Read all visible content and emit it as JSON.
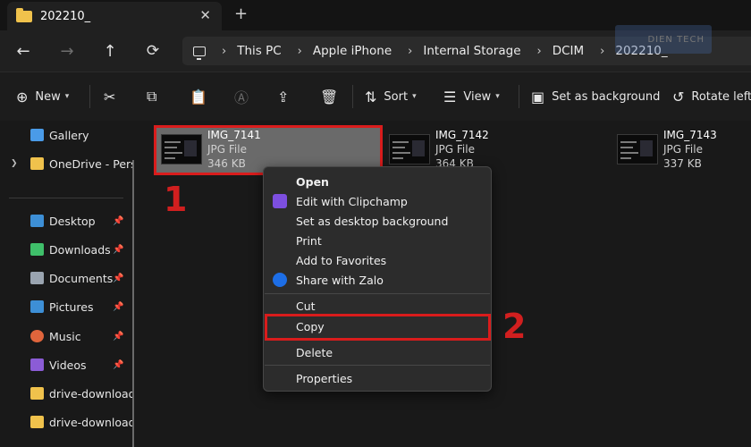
{
  "tab": {
    "title": "202210_",
    "close": "✕",
    "new_tab": "+"
  },
  "nav": {
    "back": "←",
    "forward": "→",
    "up": "↑",
    "refresh": "⟳"
  },
  "breadcrumb": {
    "separator": "›",
    "items": [
      "This PC",
      "Apple iPhone",
      "Internal Storage",
      "DCIM",
      "202210_"
    ]
  },
  "watermark": "DIEN TECH",
  "toolbar": {
    "new_label": "New",
    "sort_label": "Sort",
    "view_label": "View",
    "set_background_label": "Set as background",
    "rotate_left_label": "Rotate left",
    "icons": [
      "plus-circle-icon",
      "cut-icon",
      "copy-icon",
      "paste-icon",
      "rename-icon",
      "share-icon",
      "delete-icon",
      "sort-icon",
      "view-icon",
      "wallpaper-icon",
      "rotate-left-icon"
    ]
  },
  "sidebar": {
    "items": [
      {
        "label": "Gallery",
        "icon": "gallery-icon",
        "color": "#4a9be8",
        "pinned": false,
        "expandable": false
      },
      {
        "label": "OneDrive - Perso",
        "icon": "folder-icon",
        "color": "#f0c24c",
        "pinned": false,
        "expandable": true
      },
      {
        "label": "Desktop",
        "icon": "desktop-icon",
        "color": "#3d8fd6",
        "pinned": true,
        "expandable": false
      },
      {
        "label": "Downloads",
        "icon": "download-icon",
        "color": "#3fbf6a",
        "pinned": true,
        "expandable": false
      },
      {
        "label": "Documents",
        "icon": "documents-icon",
        "color": "#9aa4b0",
        "pinned": true,
        "expandable": false
      },
      {
        "label": "Pictures",
        "icon": "pictures-icon",
        "color": "#3d8fd6",
        "pinned": true,
        "expandable": false
      },
      {
        "label": "Music",
        "icon": "music-icon",
        "color": "#e0653c",
        "pinned": true,
        "expandable": false
      },
      {
        "label": "Videos",
        "icon": "videos-icon",
        "color": "#8b5cd6",
        "pinned": true,
        "expandable": false
      },
      {
        "label": "drive-download",
        "icon": "folder-icon",
        "color": "#f0c24c",
        "pinned": false,
        "expandable": false
      },
      {
        "label": "drive-download",
        "icon": "folder-icon",
        "color": "#f0c24c",
        "pinned": false,
        "expandable": false
      }
    ],
    "pin_glyph": "📌"
  },
  "files": [
    {
      "name": "IMG_7141",
      "type": "JPG File",
      "size": "346 KB",
      "selected": true
    },
    {
      "name": "IMG_7142",
      "type": "JPG File",
      "size": "364 KB",
      "selected": false
    },
    {
      "name": "IMG_7143",
      "type": "JPG File",
      "size": "337 KB",
      "selected": false
    }
  ],
  "context_menu": {
    "items": [
      {
        "label": "Open",
        "bold": true,
        "icon": ""
      },
      {
        "label": "Edit with Clipchamp",
        "bold": false,
        "icon": "clipchamp-icon"
      },
      {
        "label": "Set as desktop background",
        "bold": false,
        "icon": ""
      },
      {
        "label": "Print",
        "bold": false,
        "icon": ""
      },
      {
        "label": "Add to Favorites",
        "bold": false,
        "icon": ""
      },
      {
        "label": "Share with Zalo",
        "bold": false,
        "icon": "zalo-icon"
      },
      {
        "label": "Cut",
        "bold": false,
        "icon": ""
      },
      {
        "label": "Copy",
        "bold": false,
        "icon": ""
      },
      {
        "label": "Delete",
        "bold": false,
        "icon": ""
      },
      {
        "label": "Properties",
        "bold": false,
        "icon": ""
      }
    ]
  },
  "annotations": {
    "step1": "1",
    "step2": "2",
    "color": "#d91c1c"
  }
}
